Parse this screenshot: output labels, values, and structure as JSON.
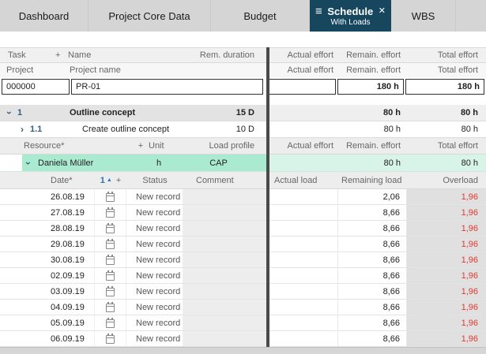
{
  "tabbar": {
    "tabs": [
      {
        "label": "Dashboard"
      },
      {
        "label": "Project Core Data"
      },
      {
        "label": "Budget"
      },
      {
        "label": "Schedule",
        "sublabel": "With Loads"
      },
      {
        "label": "WBS"
      }
    ]
  },
  "icons": {
    "menu": "≡",
    "close": "✕",
    "chevron": "›",
    "sort_asc": "▲",
    "add": "+"
  },
  "effort_headers": {
    "actual": "Actual effort",
    "remain": "Remain. effort",
    "total": "Total effort"
  },
  "task_header": {
    "task": "Task",
    "name": "Name",
    "rem_duration": "Rem. duration"
  },
  "project_header": {
    "project": "Project",
    "project_name": "Project name"
  },
  "project_row": {
    "id": "000000",
    "name": "PR-01",
    "remain": "180 h",
    "total": "180 h"
  },
  "tasks": [
    {
      "number": "1",
      "name": "Outline concept",
      "rem_duration": "15 D",
      "remain": "80 h",
      "total": "80 h"
    },
    {
      "number": "1.1",
      "name": "Create outline concept",
      "rem_duration": "10 D",
      "remain": "80 h",
      "total": "80 h"
    }
  ],
  "resource_header": {
    "resource": "Resource*",
    "unit": "Unit",
    "load_profile": "Load profile"
  },
  "resource_row": {
    "name": "Daniela Müller",
    "unit": "h",
    "load_profile": "CAP",
    "remain": "80 h",
    "total": "80 h"
  },
  "load_header": {
    "date": "Date*",
    "sort_number": "1",
    "status": "Status",
    "comment": "Comment",
    "actual": "Actual load",
    "remaining": "Remaining load",
    "overload": "Overload"
  },
  "load_rows": [
    {
      "date": "26.08.19",
      "status": "New record",
      "remaining": "2,06",
      "overload": "1,96"
    },
    {
      "date": "27.08.19",
      "status": "New record",
      "remaining": "8,66",
      "overload": "1,96"
    },
    {
      "date": "28.08.19",
      "status": "New record",
      "remaining": "8,66",
      "overload": "1,96"
    },
    {
      "date": "29.08.19",
      "status": "New record",
      "remaining": "8,66",
      "overload": "1,96"
    },
    {
      "date": "30.08.19",
      "status": "New record",
      "remaining": "8,66",
      "overload": "1,96"
    },
    {
      "date": "02.09.19",
      "status": "New record",
      "remaining": "8,66",
      "overload": "1,96"
    },
    {
      "date": "03.09.19",
      "status": "New record",
      "remaining": "8,66",
      "overload": "1,96"
    },
    {
      "date": "04.09.19",
      "status": "New record",
      "remaining": "8,66",
      "overload": "1,96"
    },
    {
      "date": "05.09.19",
      "status": "New record",
      "remaining": "8,66",
      "overload": "1,96"
    },
    {
      "date": "06.09.19",
      "status": "New record",
      "remaining": "8,66",
      "overload": "1,96"
    }
  ],
  "colors": {
    "active_tab": "#17465f",
    "selected_row": "#a9ead1",
    "overload_text": "#e03a2f"
  }
}
